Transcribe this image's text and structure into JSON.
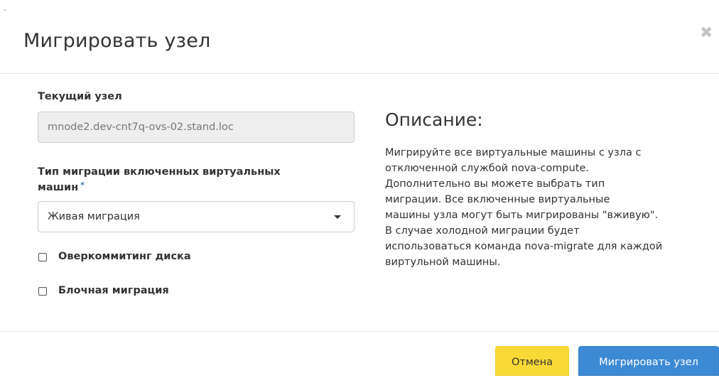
{
  "modal": {
    "title": "Мигрировать узел",
    "close_icon": "times-icon"
  },
  "form": {
    "current_node": {
      "label": "Текущий узел",
      "value": "mnode2.dev-cnt7q-ovs-02.stand.loc"
    },
    "migration_type": {
      "label_line1": "Тип миграции включенных виртуальных",
      "label_line2": "машин",
      "required_mark": "*",
      "selected": "Живая миграция"
    },
    "checkboxes": [
      {
        "label": "Оверкоммитинг диска",
        "checked": false
      },
      {
        "label": "Блочная миграция",
        "checked": false
      }
    ]
  },
  "description": {
    "title": "Описание:",
    "lines": [
      "Мигрируйте все виртуальные машины с узла с",
      "отключенной службой nova-compute.",
      "Дополнительно вы можете выбрать тип",
      "миграции. Все включенные виртуальные",
      "машины узла могут быть мигрированы \"вживую\".",
      "В случае холодной миграции будет",
      "использоваться команда nova-migrate для каждой",
      "виртульной машины."
    ]
  },
  "footer": {
    "cancel_label": "Отмена",
    "submit_label": "Мигрировать узел"
  },
  "colors": {
    "cancel_bg": "#f9d936",
    "primary_bg": "#3d8ad4",
    "required_star": "#3576c9"
  }
}
